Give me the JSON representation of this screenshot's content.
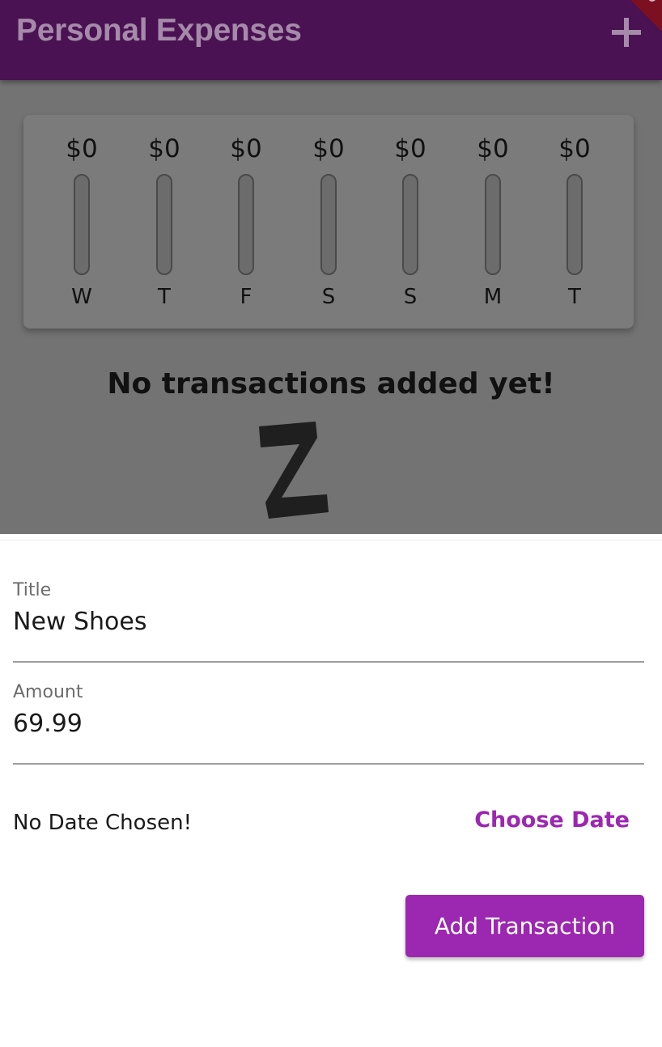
{
  "appbar": {
    "title": "Personal Expenses",
    "action_icon": "add-icon"
  },
  "chart": {
    "days": [
      {
        "day": "W",
        "amount": "$0",
        "spending_fraction": 0
      },
      {
        "day": "T",
        "amount": "$0",
        "spending_fraction": 0
      },
      {
        "day": "F",
        "amount": "$0",
        "spending_fraction": 0
      },
      {
        "day": "S",
        "amount": "$0",
        "spending_fraction": 0
      },
      {
        "day": "S",
        "amount": "$0",
        "spending_fraction": 0
      },
      {
        "day": "M",
        "amount": "$0",
        "spending_fraction": 0
      },
      {
        "day": "T",
        "amount": "$0",
        "spending_fraction": 0
      }
    ]
  },
  "empty_state": {
    "message": "No transactions added yet!",
    "image_icon": "zz-sleep-icon"
  },
  "form": {
    "title_label": "Title",
    "title_value": "New Shoes",
    "amount_label": "Amount",
    "amount_value": "69.99",
    "date_status": "No Date Chosen!",
    "choose_date_label": "Choose Date",
    "submit_label": "Add Transaction"
  },
  "colors": {
    "appbar": "#4a1253",
    "accent": "#9c27b0",
    "scrim": "#737373",
    "debug_banner": "#7d1020"
  }
}
